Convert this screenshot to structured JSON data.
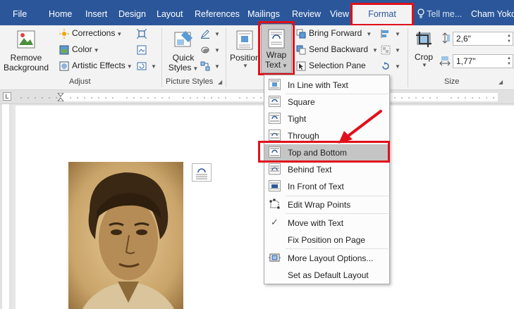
{
  "tabs": [
    "File",
    "Home",
    "Insert",
    "Design",
    "Layout",
    "References",
    "Mailings",
    "Review",
    "View"
  ],
  "active_tab": "Format",
  "tell_me": "Tell me...",
  "user": "Cham Yoko",
  "ribbon": {
    "remove_background": [
      "Remove",
      "Background"
    ],
    "corrections": "Corrections",
    "color": "Color",
    "artistic_effects": "Artistic Effects",
    "adjust_label": "Adjust",
    "quick_styles": [
      "Quick",
      "Styles"
    ],
    "picture_styles_label": "Picture Styles",
    "position": "Position",
    "wrap_text": [
      "Wrap",
      "Text"
    ],
    "bring_forward": "Bring Forward",
    "send_backward": "Send Backward",
    "selection_pane": "Selection Pane",
    "crop": "Crop",
    "height_value": "2,6\"",
    "width_value": "1,77\"",
    "size_label": "Size"
  },
  "wrap_menu": {
    "items": [
      "In Line with Text",
      "Square",
      "Tight",
      "Through",
      "Top and Bottom",
      "Behind Text",
      "In Front of Text",
      "Edit Wrap Points",
      "Move with Text",
      "Fix Position on Page",
      "More Layout Options...",
      "Set as Default Layout"
    ],
    "highlighted": "Top and Bottom"
  },
  "colors": {
    "title_bar": "#2b579a",
    "highlight_box": "#e0101b",
    "menu_hover": "#c5c5c5"
  }
}
